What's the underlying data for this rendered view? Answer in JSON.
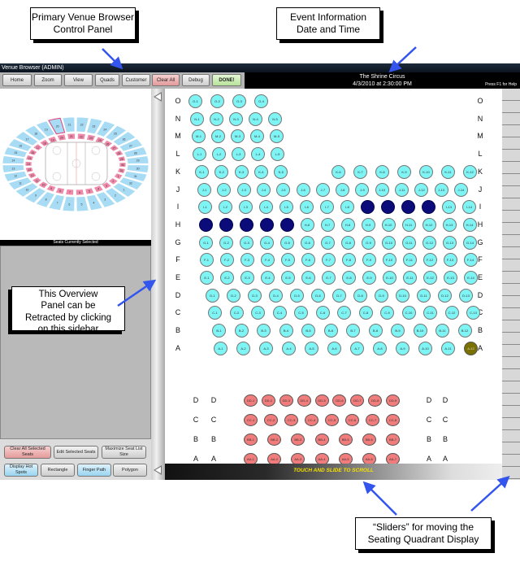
{
  "annotations": {
    "control_panel": [
      "Primary Venue Browser",
      "Control Panel"
    ],
    "event_info": [
      "Event Information",
      "Date and Time"
    ],
    "overview_panel": [
      "This Overview",
      "Panel can be",
      "Retracted by clicking",
      "on this sidebar"
    ],
    "sliders": [
      "“Sliders” for moving the",
      "Seating Quadrant Display"
    ]
  },
  "window": {
    "title": "Venue Browser (ADMIN)"
  },
  "toolbar": {
    "buttons": [
      {
        "label": "Home",
        "style": "normal"
      },
      {
        "label": "Zoom",
        "style": "normal"
      },
      {
        "label": "View",
        "style": "normal"
      },
      {
        "label": "Quads",
        "style": "normal"
      },
      {
        "label": "Customer",
        "style": "normal"
      },
      {
        "label": "Clear All",
        "style": "red"
      },
      {
        "label": "Debug",
        "style": "normal"
      },
      {
        "label": "DONE!",
        "style": "green"
      }
    ]
  },
  "event": {
    "name": "The Shrine Circus",
    "datetime": "4/3/2010 at 2:30:00 PM",
    "help": "Press F1 for Help"
  },
  "overview": {
    "outer_sections": [
      "20",
      "21",
      "22",
      "23",
      "24",
      "25",
      "26",
      "27",
      "28",
      "29",
      "30",
      "31",
      "32",
      "1",
      "2",
      "3",
      "4",
      "5",
      "6",
      "7",
      "8",
      "9",
      "10",
      "11",
      "12",
      "13",
      "14",
      "15",
      "16",
      "17",
      "18",
      "19"
    ],
    "inner_sections": [
      "20",
      "21",
      "22",
      "23",
      "25",
      "26",
      "27",
      "28",
      "29",
      "30",
      "31",
      "1",
      "2",
      "3",
      "4",
      "5",
      "6",
      "7",
      "8",
      "9",
      "10",
      "11",
      "12",
      "13",
      "14",
      "15",
      "16",
      "17",
      "18",
      "19"
    ],
    "highlighted_section": "20"
  },
  "selected_panel": {
    "title": "Seats Currently Selected"
  },
  "bottom_buttons": [
    {
      "label": "Clear All Selected Seats",
      "style": "red"
    },
    {
      "label": "Edit Selected Seats",
      "style": "normal"
    },
    {
      "label": "Maximize Seat List Size",
      "style": "normal"
    },
    {
      "label": "Display Hot Spots",
      "style": "blue"
    },
    {
      "label": "Rectangle",
      "style": "normal"
    },
    {
      "label": "Finger Path",
      "style": "blue"
    },
    {
      "label": "Polygon",
      "style": "normal"
    }
  ],
  "seat_colors": {
    "available": "#7ff4f4",
    "selected": "#0b0b7a",
    "held": "#7a7000",
    "lower": "#f07c7c"
  },
  "upper_rows": [
    {
      "row": "O",
      "seats": 4
    },
    {
      "row": "N",
      "seats": 5
    },
    {
      "row": "M",
      "seats": 5
    },
    {
      "row": "L",
      "seats": 5
    },
    {
      "row": "K",
      "seats": 12,
      "gap_after": 5
    },
    {
      "row": "J",
      "seats": 14
    },
    {
      "row": "I",
      "seats": 14,
      "selected": [
        9,
        10,
        11,
        12
      ]
    },
    {
      "row": "H",
      "seats": 14,
      "selected": [
        1,
        2,
        3,
        4,
        5
      ]
    },
    {
      "row": "G",
      "seats": 14
    },
    {
      "row": "F",
      "seats": 14
    },
    {
      "row": "E",
      "seats": 14
    },
    {
      "row": "D",
      "seats": 13
    },
    {
      "row": "C",
      "seats": 13
    },
    {
      "row": "B",
      "seats": 12
    },
    {
      "row": "A",
      "seats": 12,
      "held": [
        12
      ]
    }
  ],
  "lower_rows": [
    {
      "row": "DD",
      "label": "D",
      "seats": 9
    },
    {
      "row": "CC",
      "label": "C",
      "seats": 8
    },
    {
      "row": "BB",
      "label": "B",
      "seats": 7
    },
    {
      "row": "AA",
      "label": "A",
      "seats": 7
    }
  ],
  "scroll": {
    "horizontal_label": "TOUCH AND SLIDE TO SCROLL"
  }
}
